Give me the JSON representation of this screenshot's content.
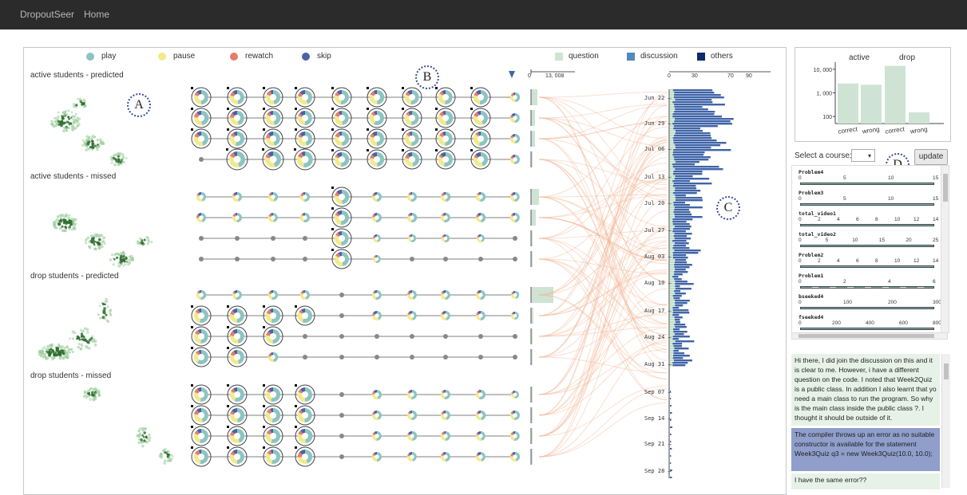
{
  "nav": {
    "brand": "DropoutSeer",
    "home": "Home"
  },
  "legend": {
    "items": [
      {
        "label": "play",
        "color": "#8cc4c2"
      },
      {
        "label": "pause",
        "color": "#f2ea8a"
      },
      {
        "label": "rewatch",
        "color": "#e87a6a"
      },
      {
        "label": "skip",
        "color": "#4a63a6"
      },
      {
        "label": "question",
        "color": "#cce5d3"
      },
      {
        "label": "discussion",
        "color": "#4f8ac0"
      },
      {
        "label": "others",
        "color": "#0d2b6b"
      }
    ]
  },
  "groups": [
    "active students - predicted",
    "active students - missed",
    "drop students - predicted",
    "drop students - missed"
  ],
  "markers": [
    "A",
    "B",
    "C",
    "D"
  ],
  "bar_axis": {
    "ticks": [
      "0",
      "13, 008"
    ]
  },
  "hist_axis": {
    "ticks": [
      "0",
      "30",
      "70",
      "90"
    ]
  },
  "dates": [
    "Jun 22",
    "Jun 29",
    "Jul 06",
    "Jul 13",
    "Jul 20",
    "Jul 27",
    "Aug 03",
    "Aug 10",
    "Aug 17",
    "Aug 24",
    "Aug 31",
    "Sep 07",
    "Sep 14",
    "Sep 21",
    "Sep 28"
  ],
  "chart_data": {
    "type": "bar",
    "series": [
      {
        "name": "active",
        "categories": [
          "correct",
          "wrong"
        ],
        "values": [
          2500,
          2200
        ]
      },
      {
        "name": "drop",
        "categories": [
          "correct",
          "wrong"
        ],
        "values": [
          14000,
          150
        ]
      }
    ],
    "categories": [
      "correct",
      "wrong",
      "correct",
      "wrong"
    ],
    "values": [
      2500,
      2200,
      14000,
      150
    ],
    "yscale": "log",
    "yticks": [
      "10, 000",
      "1, 000",
      "100"
    ],
    "group_labels": [
      "active",
      "drop"
    ]
  },
  "filter": {
    "label": "Select a course:",
    "select_value": "▾",
    "update_label": "update",
    "features": [
      {
        "name": "Problem4",
        "ticks": [
          "0",
          "5",
          "10",
          "15"
        ]
      },
      {
        "name": "Problem3",
        "ticks": [
          "0",
          "5",
          "10",
          "15"
        ]
      },
      {
        "name": "total_video1",
        "ticks": [
          "0",
          "2",
          "4",
          "6",
          "8",
          "10",
          "12",
          "14"
        ]
      },
      {
        "name": "total_video2",
        "ticks": [
          "0",
          "5",
          "10",
          "15",
          "20",
          "25"
        ]
      },
      {
        "name": "Problem2",
        "ticks": [
          "0",
          "2",
          "4",
          "6",
          "8",
          "10",
          "12",
          "14"
        ]
      },
      {
        "name": "Problem1",
        "ticks": [
          "0",
          "2",
          "4",
          "6"
        ]
      },
      {
        "name": "bseeked4",
        "ticks": [
          "0",
          "100",
          "200",
          "300"
        ]
      },
      {
        "name": "fseeked4",
        "ticks": [
          "0",
          "200",
          "400",
          "600",
          "800"
        ]
      }
    ]
  },
  "posts": [
    {
      "text": "Hi there, I did join the discussion on this and it is clear to me. However, i have a different question on the code. I noted that Week2Quiz is a public class. In addition I also learnt that yo need a main class to run the program. So why is the main class inside the public class ?. I thought it should be outside of it."
    },
    {
      "text": "The compiler throws up an error as no suitable constructor is available for the statement Week3Quiz q3 = new Week3Quiz(10.0, 10.0);"
    },
    {
      "text": "I have the same error??"
    }
  ]
}
